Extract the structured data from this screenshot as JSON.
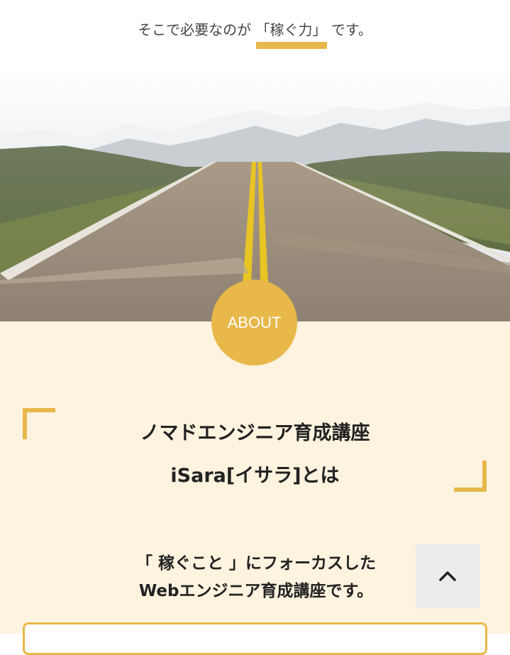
{
  "intro": {
    "prefix": "そこで必要なのが",
    "highlight": "「稼ぐ力」",
    "suffix": "です。"
  },
  "hero": {
    "image": "road-to-mountains-photo"
  },
  "about": {
    "badge": "ABOUT",
    "title_line1": "ノマドエンジニア育成講座",
    "title_line2": "iSara[イサラ]とは",
    "subtitle_line1": "「 稼ぐこと 」にフォーカスした",
    "subtitle_line2": "Webエンジニア育成講座です。"
  },
  "scroll_top": {
    "icon": "chevron-up-icon"
  },
  "colors": {
    "accent": "#e9b84a",
    "section_bg": "#fdf3df",
    "text": "#222222",
    "scroll_bg": "#ececec"
  }
}
